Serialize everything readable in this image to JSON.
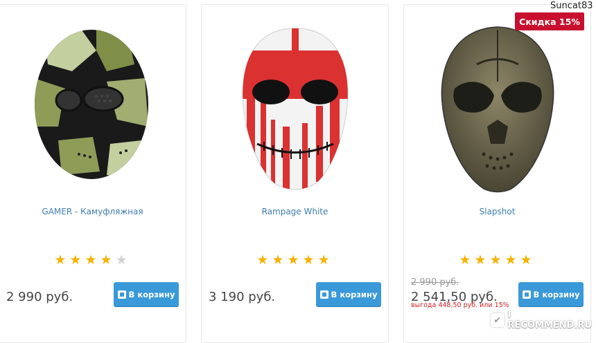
{
  "user": {
    "name": "Suncat83"
  },
  "watermark": {
    "text": "I RECOMMEND.RU",
    "icon": "recommend-logo-icon"
  },
  "cart_label": "В корзину",
  "products": [
    {
      "title": "GAMER - Камуфляжная",
      "rating": 4,
      "rating_max": 5,
      "price": "2 990 руб.",
      "colors": {
        "primary": "#111111",
        "secondary": "#8c9a5a"
      }
    },
    {
      "title": "Rampage White",
      "rating": 5,
      "rating_max": 5,
      "price": "3 190 руб.",
      "colors": {
        "primary": "#f2f2f2",
        "secondary": "#d91c1c"
      }
    },
    {
      "title": "Slapshot",
      "rating": 5,
      "rating_max": 5,
      "badge": "Скидка 15%",
      "old_price": "2 990 руб.",
      "price": "2 541,50 руб.",
      "savings": "выгода 448,50 руб. или 15%",
      "colors": {
        "primary": "#6e6a52",
        "secondary": "#2a2a22"
      }
    }
  ],
  "accent_colors": {
    "button": "#3a99d8",
    "star": "#f5b300",
    "badge": "#c8102e",
    "link": "#3d7fb0"
  }
}
